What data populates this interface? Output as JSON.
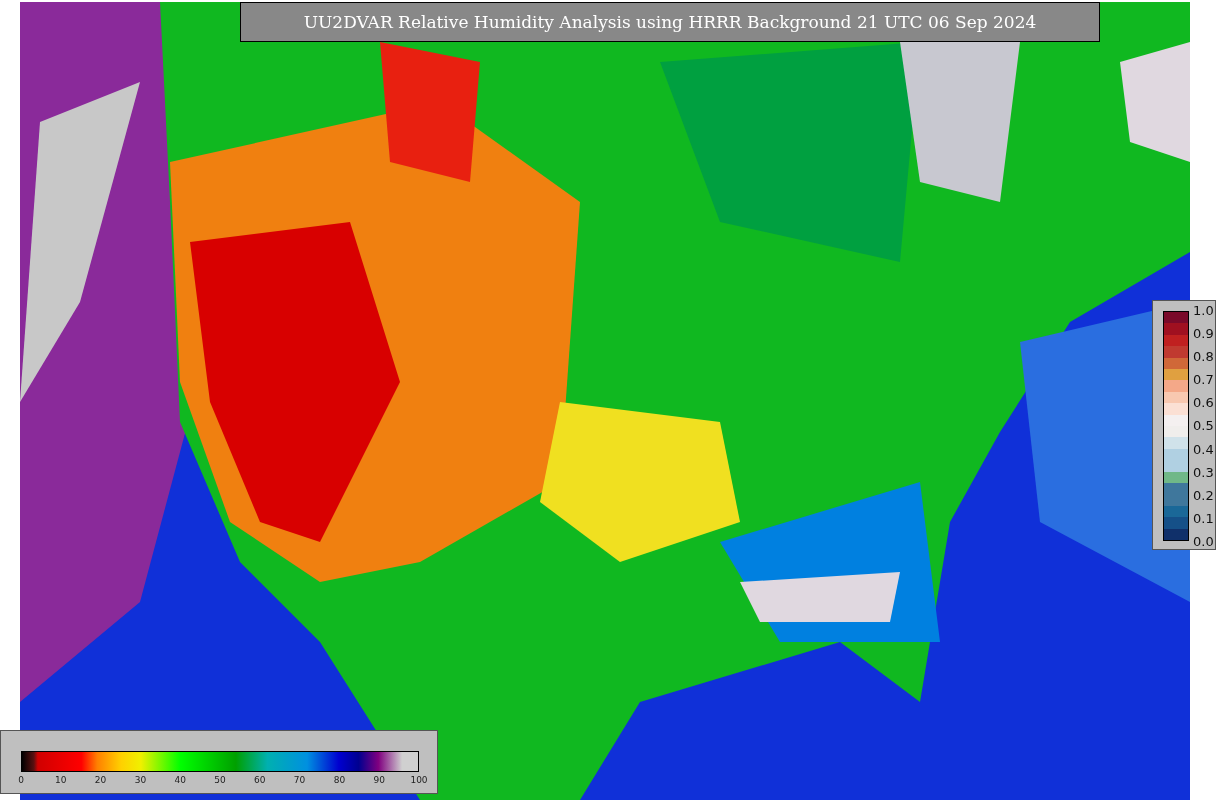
{
  "title": "UU2DVAR Relative Humidity Analysis using HRRR Background 21 UTC 06 Sep 2024",
  "humidity_colorbar": {
    "ticks": [
      "0",
      "10",
      "20",
      "30",
      "40",
      "50",
      "60",
      "70",
      "80",
      "90",
      "100"
    ]
  },
  "ratio_colorbar": {
    "ticks": [
      "1.0",
      "0.9",
      "0.8",
      "0.7",
      "0.6",
      "0.5",
      "0.4",
      "0.3",
      "0.2",
      "0.1",
      "0.0"
    ]
  }
}
